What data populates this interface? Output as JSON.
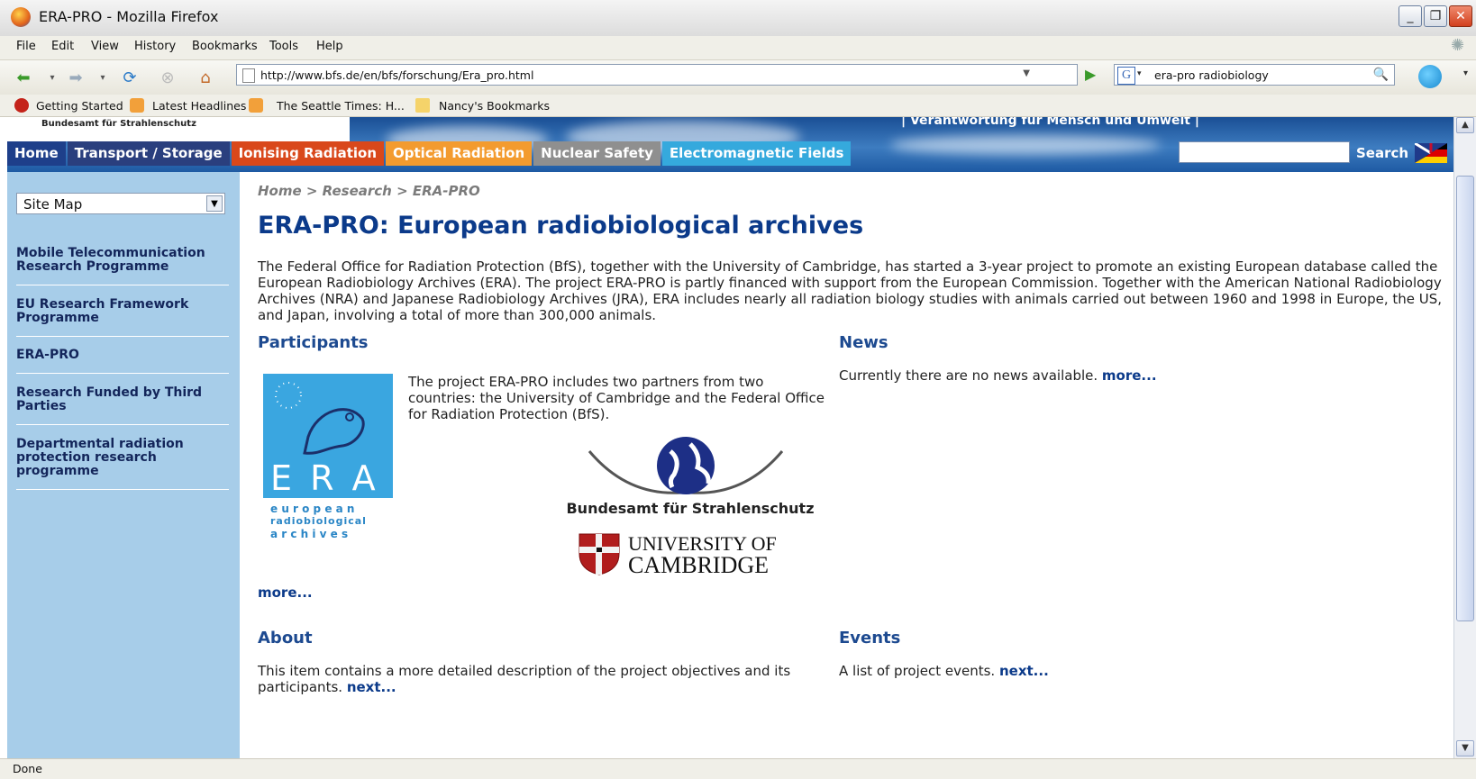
{
  "window": {
    "title": "ERA-PRO - Mozilla Firefox"
  },
  "menu": [
    "File",
    "Edit",
    "View",
    "History",
    "Bookmarks",
    "Tools",
    "Help"
  ],
  "address": {
    "url": "http://www.bfs.de/en/bfs/forschung/Era_pro.html"
  },
  "search_bar": {
    "engine_icon": "G",
    "query": "era-pro radiobiology"
  },
  "bookmarks": [
    "Getting Started",
    "Latest Headlines",
    "The Seattle Times: H...",
    "Nancy's Bookmarks"
  ],
  "banner": {
    "agency": "Bundesamt für Strahlenschutz",
    "slogan": "| Verantwortung für Mensch und Umwelt |"
  },
  "tabs": [
    {
      "label": "Home",
      "color": "#1e3f8a"
    },
    {
      "label": "Transport / Storage",
      "color": "#2a3f7e"
    },
    {
      "label": "Ionising Radiation",
      "color": "#d9481b"
    },
    {
      "label": "Optical Radiation",
      "color": "#f39b2f"
    },
    {
      "label": "Nuclear Safety",
      "color": "#8f8f8f"
    },
    {
      "label": "Electromagnetic Fields",
      "color": "#35a9dd"
    }
  ],
  "site_search": {
    "label": "Search"
  },
  "sidebar": {
    "dropdown": "Site Map",
    "items": [
      "Mobile Telecommunication Research Programme",
      "EU Research Framework Programme",
      "ERA-PRO",
      "Research Funded by Third Parties",
      "Departmental radiation protection research programme"
    ]
  },
  "main": {
    "breadcrumb": "Home > Research > ERA-PRO",
    "title": "ERA-PRO: European radiobiological archives",
    "intro": "The Federal Office for Radiation Protection (BfS), together with the University of Cambridge, has started a 3-year project to promote an existing European database called the European Radiobiology Archives (ERA). The project ERA-PRO is partly financed with support from the European Commission. Together with the American National Radiobiology Archives (NRA) and Japanese Radiobiology Archives (JRA), ERA includes nearly all radiation biology studies with animals carried out between 1960 and 1998 in Europe, the US, and Japan, involving a total of more than 300,000 animals.",
    "participants": {
      "heading": "Participants",
      "text": "The project ERA-PRO includes two partners from two countries: the University of Cambridge and the Federal Office for Radiation Protection (BfS).",
      "more": "more...",
      "era_logo": {
        "letters": "E R A",
        "line1": "e u r o p e a n",
        "line2": "radiobiological",
        "line3": "a r c h i v e s"
      },
      "bfs_logo_text": "Bundesamt für Strahlenschutz",
      "cambridge": {
        "line1": "UNIVERSITY OF",
        "line2": "CAMBRIDGE"
      }
    },
    "news": {
      "heading": "News",
      "text": "Currently there are no news available.",
      "more": "more..."
    },
    "about": {
      "heading": "About",
      "text": "This item contains a more detailed description of the project objectives and its participants.",
      "next": "next..."
    },
    "events": {
      "heading": "Events",
      "text": "A list of project events.",
      "next": "next..."
    }
  },
  "status": {
    "text": "Done"
  }
}
